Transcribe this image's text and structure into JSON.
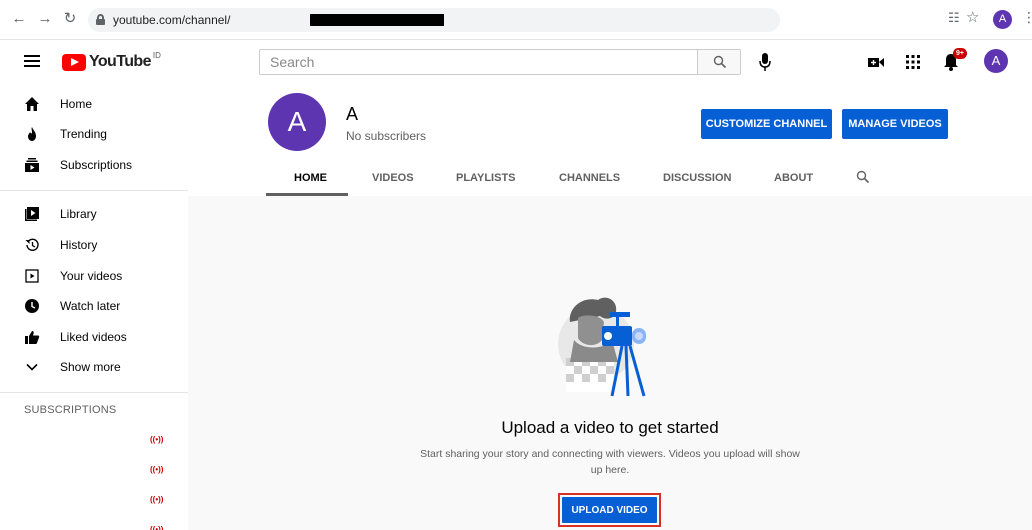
{
  "browser": {
    "url": "youtube.com/channel/",
    "avatar_letter": "A"
  },
  "masthead": {
    "logo_text": "YouTube",
    "region": "ID",
    "search_placeholder": "Search",
    "notification_count": "9+",
    "avatar_letter": "A"
  },
  "sidebar": {
    "items": [
      {
        "label": "Home",
        "icon": "home-icon"
      },
      {
        "label": "Trending",
        "icon": "trending-icon"
      },
      {
        "label": "Subscriptions",
        "icon": "subscriptions-icon"
      },
      {
        "label": "Library",
        "icon": "library-icon"
      },
      {
        "label": "History",
        "icon": "history-icon"
      },
      {
        "label": "Your videos",
        "icon": "your-videos-icon"
      },
      {
        "label": "Watch later",
        "icon": "watch-later-icon"
      },
      {
        "label": "Liked videos",
        "icon": "thumbs-up-icon"
      },
      {
        "label": "Show more",
        "icon": "chevron-down-icon"
      }
    ],
    "subscriptions_heading": "SUBSCRIPTIONS",
    "live_indicator": "((•))"
  },
  "channel": {
    "avatar_letter": "A",
    "name": "A",
    "subscribers": "No subscribers",
    "customize_label": "CUSTOMIZE CHANNEL",
    "manage_label": "MANAGE VIDEOS",
    "tabs": [
      "HOME",
      "VIDEOS",
      "PLAYLISTS",
      "CHANNELS",
      "DISCUSSION",
      "ABOUT"
    ],
    "active_tab": "HOME"
  },
  "empty_state": {
    "title": "Upload a video to get started",
    "description": "Start sharing your story and connecting with viewers. Videos you upload will show up here.",
    "upload_label": "UPLOAD VIDEO"
  },
  "colors": {
    "accent": "#065fd4",
    "avatar": "#5e35b1",
    "highlight_border": "#d93025",
    "brand_red": "#ff0000"
  }
}
